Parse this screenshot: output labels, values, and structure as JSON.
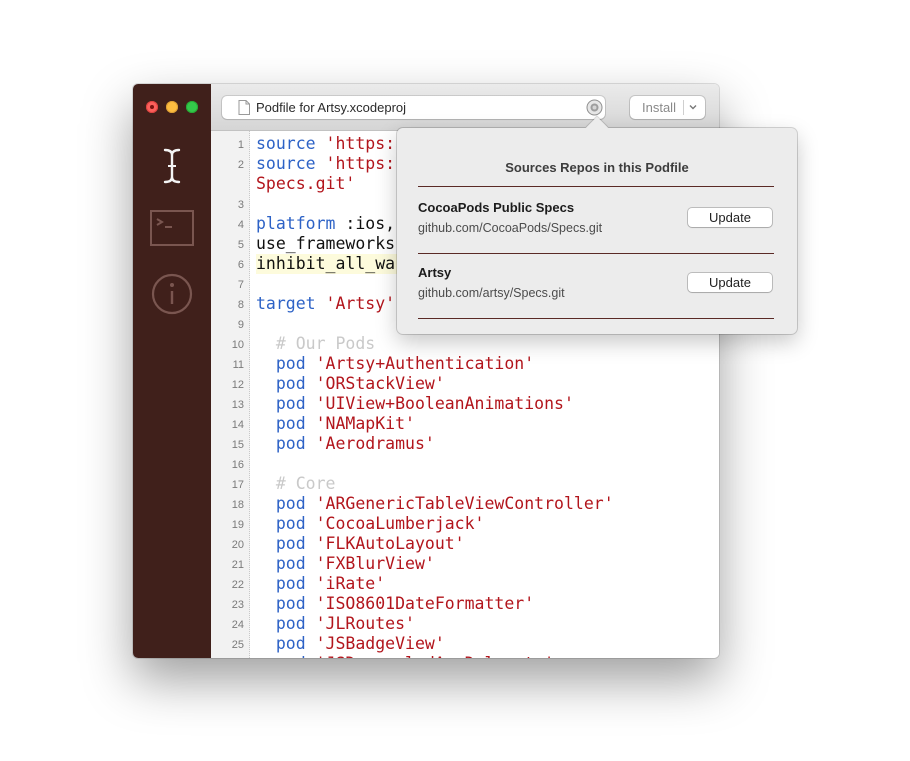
{
  "window": {
    "document_title": "Podfile for Artsy.xcodeproj",
    "install_label": "Install"
  },
  "sidebar": {
    "items": [
      {
        "name": "text-cursor-icon"
      },
      {
        "name": "terminal-icon"
      },
      {
        "name": "info-icon"
      }
    ]
  },
  "editor": {
    "lines": [
      {
        "n": "1",
        "tokens": [
          {
            "t": "source",
            "c": "kw"
          },
          {
            "t": " ",
            "c": "plain"
          },
          {
            "t": "'https:",
            "c": "str"
          }
        ]
      },
      {
        "n": "2",
        "tokens": [
          {
            "t": "source",
            "c": "kw"
          },
          {
            "t": " ",
            "c": "plain"
          },
          {
            "t": "'https:",
            "c": "str"
          }
        ]
      },
      {
        "n": "",
        "tokens": [
          {
            "t": "Specs.git'",
            "c": "str"
          }
        ]
      },
      {
        "n": "3",
        "tokens": []
      },
      {
        "n": "4",
        "tokens": [
          {
            "t": "platform",
            "c": "kw"
          },
          {
            "t": " :ios,",
            "c": "plain"
          }
        ]
      },
      {
        "n": "5",
        "tokens": [
          {
            "t": "use_frameworks",
            "c": "plain"
          }
        ]
      },
      {
        "n": "6",
        "tokens": [
          {
            "t": "inhibit_all_wa",
            "c": "plain"
          }
        ],
        "highlight": true
      },
      {
        "n": "7",
        "tokens": []
      },
      {
        "n": "8",
        "tokens": [
          {
            "t": "target",
            "c": "kw"
          },
          {
            "t": " ",
            "c": "plain"
          },
          {
            "t": "'Artsy'",
            "c": "str"
          }
        ]
      },
      {
        "n": "9",
        "tokens": []
      },
      {
        "n": "10",
        "tokens": [
          {
            "t": "  # Our Pods",
            "c": "comment"
          }
        ]
      },
      {
        "n": "11",
        "tokens": [
          {
            "t": "  pod",
            "c": "kw"
          },
          {
            "t": " ",
            "c": "plain"
          },
          {
            "t": "'Artsy+Authentication'",
            "c": "str"
          }
        ]
      },
      {
        "n": "12",
        "tokens": [
          {
            "t": "  pod",
            "c": "kw"
          },
          {
            "t": " ",
            "c": "plain"
          },
          {
            "t": "'ORStackView'",
            "c": "str"
          }
        ]
      },
      {
        "n": "13",
        "tokens": [
          {
            "t": "  pod",
            "c": "kw"
          },
          {
            "t": " ",
            "c": "plain"
          },
          {
            "t": "'UIView+BooleanAnimations'",
            "c": "str"
          }
        ]
      },
      {
        "n": "14",
        "tokens": [
          {
            "t": "  pod",
            "c": "kw"
          },
          {
            "t": " ",
            "c": "plain"
          },
          {
            "t": "'NAMapKit'",
            "c": "str"
          }
        ]
      },
      {
        "n": "15",
        "tokens": [
          {
            "t": "  pod",
            "c": "kw"
          },
          {
            "t": " ",
            "c": "plain"
          },
          {
            "t": "'Aerodramus'",
            "c": "str"
          }
        ]
      },
      {
        "n": "16",
        "tokens": []
      },
      {
        "n": "17",
        "tokens": [
          {
            "t": "  # Core",
            "c": "comment"
          }
        ]
      },
      {
        "n": "18",
        "tokens": [
          {
            "t": "  pod",
            "c": "kw"
          },
          {
            "t": " ",
            "c": "plain"
          },
          {
            "t": "'ARGenericTableViewController'",
            "c": "str"
          }
        ]
      },
      {
        "n": "19",
        "tokens": [
          {
            "t": "  pod",
            "c": "kw"
          },
          {
            "t": " ",
            "c": "plain"
          },
          {
            "t": "'CocoaLumberjack'",
            "c": "str"
          }
        ]
      },
      {
        "n": "20",
        "tokens": [
          {
            "t": "  pod",
            "c": "kw"
          },
          {
            "t": " ",
            "c": "plain"
          },
          {
            "t": "'FLKAutoLayout'",
            "c": "str"
          }
        ]
      },
      {
        "n": "21",
        "tokens": [
          {
            "t": "  pod",
            "c": "kw"
          },
          {
            "t": " ",
            "c": "plain"
          },
          {
            "t": "'FXBlurView'",
            "c": "str"
          }
        ]
      },
      {
        "n": "22",
        "tokens": [
          {
            "t": "  pod",
            "c": "kw"
          },
          {
            "t": " ",
            "c": "plain"
          },
          {
            "t": "'iRate'",
            "c": "str"
          }
        ]
      },
      {
        "n": "23",
        "tokens": [
          {
            "t": "  pod",
            "c": "kw"
          },
          {
            "t": " ",
            "c": "plain"
          },
          {
            "t": "'ISO8601DateFormatter'",
            "c": "str"
          }
        ]
      },
      {
        "n": "24",
        "tokens": [
          {
            "t": "  pod",
            "c": "kw"
          },
          {
            "t": " ",
            "c": "plain"
          },
          {
            "t": "'JLRoutes'",
            "c": "str"
          }
        ]
      },
      {
        "n": "25",
        "tokens": [
          {
            "t": "  pod",
            "c": "kw"
          },
          {
            "t": " ",
            "c": "plain"
          },
          {
            "t": "'JSBadgeView'",
            "c": "str"
          }
        ]
      },
      {
        "n": "",
        "tokens": [
          {
            "t": "  pod",
            "c": "kw"
          },
          {
            "t": " ",
            "c": "plain"
          },
          {
            "t": "'JSDecoupledAppDelegate'",
            "c": "str"
          }
        ]
      }
    ]
  },
  "popover": {
    "title": "Sources Repos in this Podfile",
    "repos": [
      {
        "name": "CocoaPods Public Specs",
        "url": "github.com/CocoaPods/Specs.git",
        "button": "Update"
      },
      {
        "name": "Artsy",
        "url": "github.com/artsy/Specs.git",
        "button": "Update"
      }
    ]
  },
  "colors": {
    "sidebar": "#40201b",
    "keyword": "#2d62c6",
    "string": "#b2151c",
    "comment": "#c9c9c9",
    "separator": "#5a2a26"
  }
}
